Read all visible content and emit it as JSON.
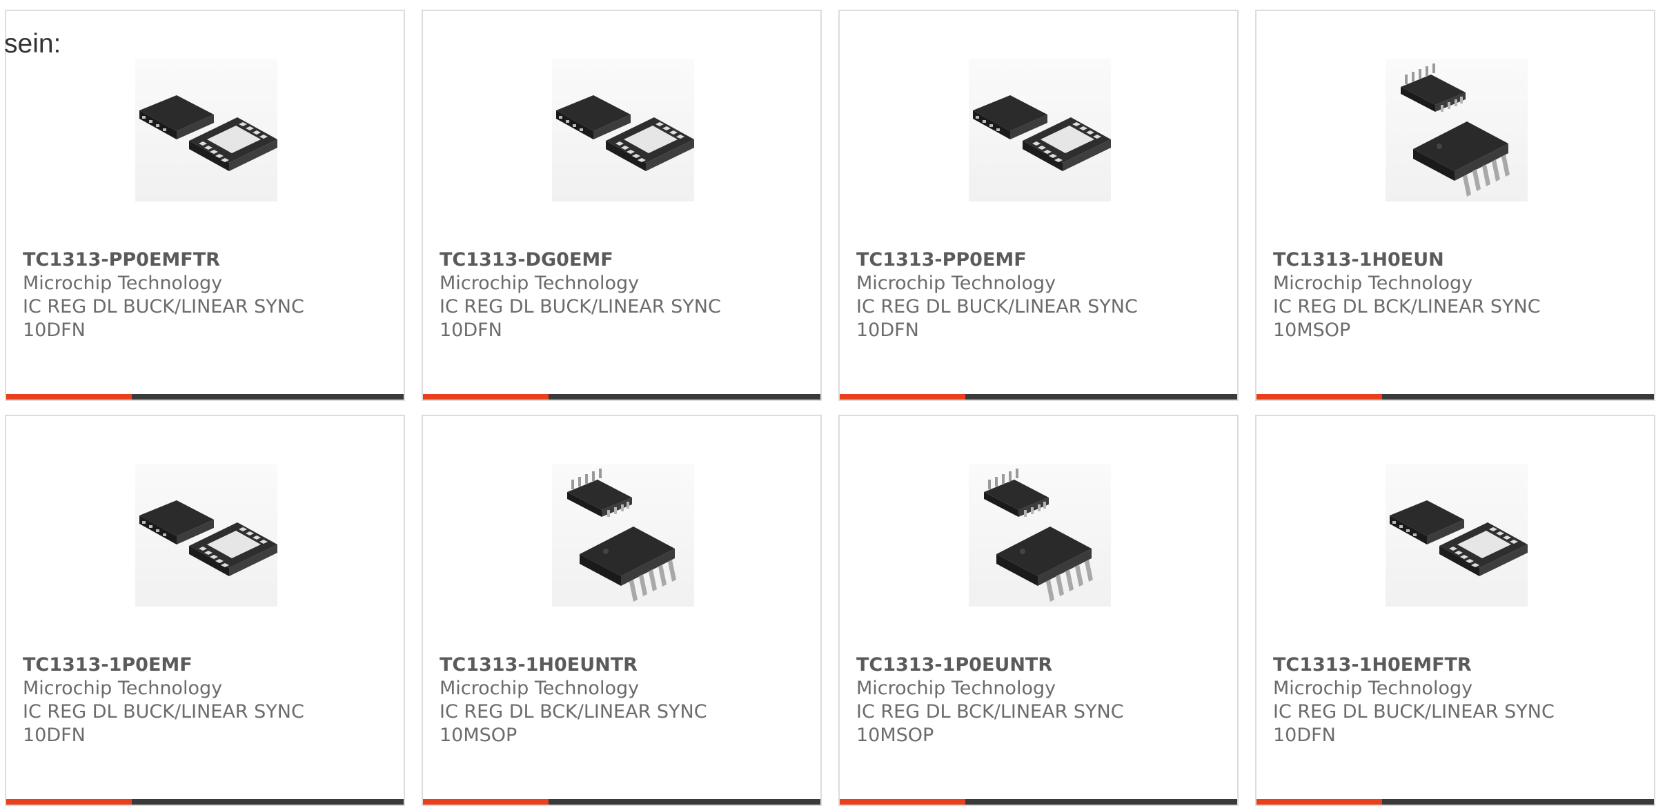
{
  "intro_text": "sein:",
  "accent_color": "#e8401c",
  "bar_color": "#3a3a3a",
  "products": [
    {
      "part_number": "TC1313-PP0EMFTR",
      "manufacturer": "Microchip Technology",
      "description_line1": "IC REG DL BUCK/LINEAR SYNC",
      "description_line2": "10DFN",
      "image_icon": "dfn-10-package-icon"
    },
    {
      "part_number": "TC1313-DG0EMF",
      "manufacturer": "Microchip Technology",
      "description_line1": "IC REG DL BUCK/LINEAR SYNC",
      "description_line2": "10DFN",
      "image_icon": "dfn-10-package-icon"
    },
    {
      "part_number": "TC1313-PP0EMF",
      "manufacturer": "Microchip Technology",
      "description_line1": "IC REG DL BUCK/LINEAR SYNC",
      "description_line2": "10DFN",
      "image_icon": "dfn-10-package-icon"
    },
    {
      "part_number": "TC1313-1H0EUN",
      "manufacturer": "Microchip Technology",
      "description_line1": "IC REG DL BCK/LINEAR SYNC",
      "description_line2": "10MSOP",
      "image_icon": "msop-10-package-icon"
    },
    {
      "part_number": "TC1313-1P0EMF",
      "manufacturer": "Microchip Technology",
      "description_line1": "IC REG DL BUCK/LINEAR SYNC",
      "description_line2": "10DFN",
      "image_icon": "dfn-10-package-icon"
    },
    {
      "part_number": "TC1313-1H0EUNTR",
      "manufacturer": "Microchip Technology",
      "description_line1": "IC REG DL BCK/LINEAR SYNC",
      "description_line2": "10MSOP",
      "image_icon": "msop-10-package-icon"
    },
    {
      "part_number": "TC1313-1P0EUNTR",
      "manufacturer": "Microchip Technology",
      "description_line1": "IC REG DL BCK/LINEAR SYNC",
      "description_line2": "10MSOP",
      "image_icon": "msop-10-package-icon"
    },
    {
      "part_number": "TC1313-1H0EMFTR",
      "manufacturer": "Microchip Technology",
      "description_line1": "IC REG DL BUCK/LINEAR SYNC",
      "description_line2": "10DFN",
      "image_icon": "dfn-10-package-icon"
    }
  ]
}
